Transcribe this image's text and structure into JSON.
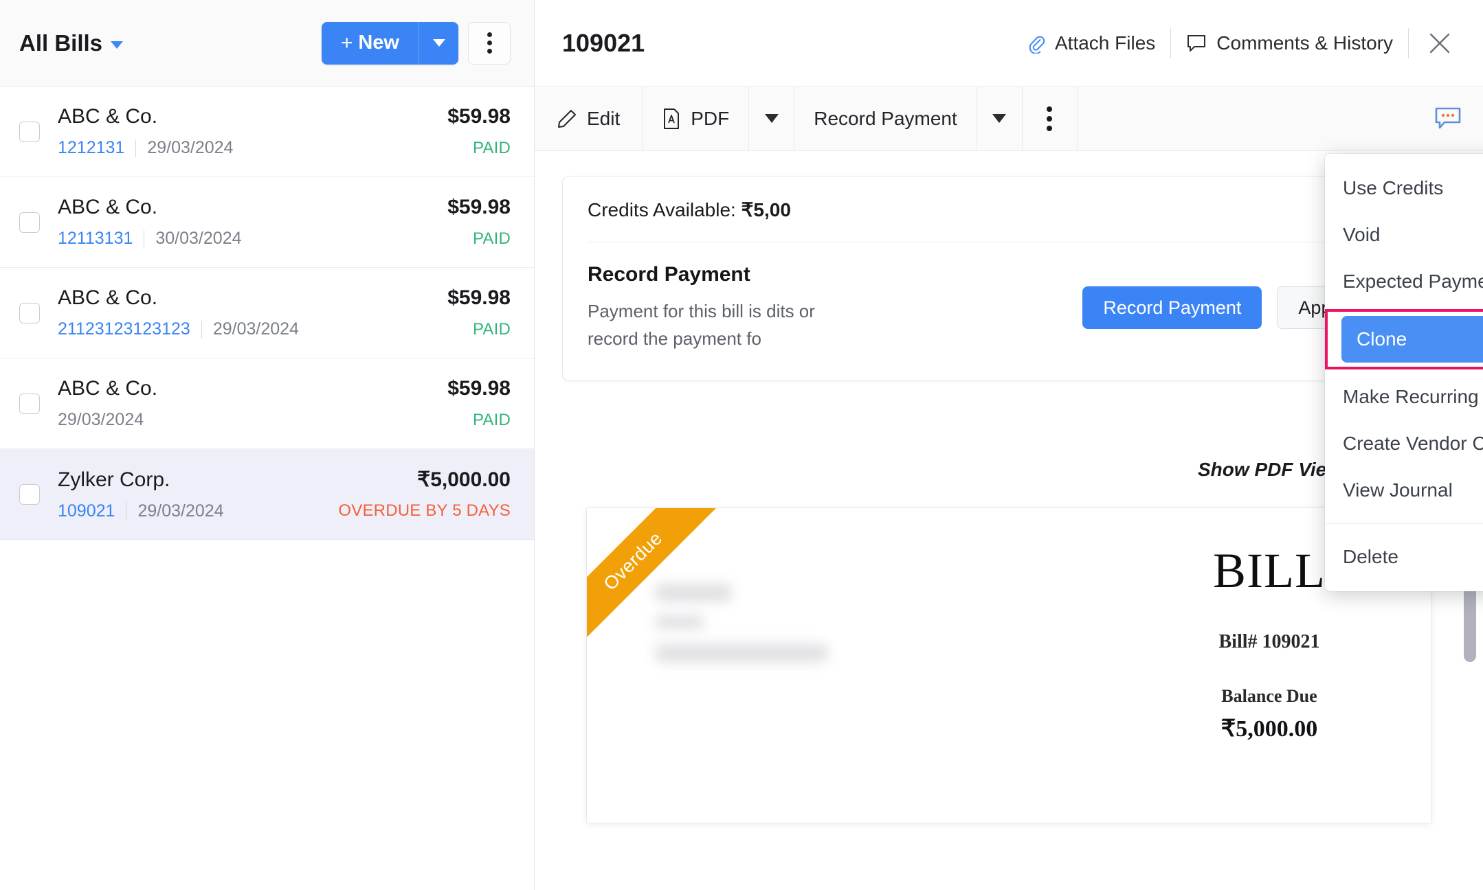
{
  "left_pane": {
    "view_label": "All Bills",
    "new_button": "+ New",
    "new_plus": "+",
    "new_text": "New",
    "bills": [
      {
        "vendor": "ABC & Co.",
        "amount": "$59.98",
        "number": "1212131",
        "date": "29/03/2024",
        "status": "PAID",
        "status_type": "paid",
        "selected": false
      },
      {
        "vendor": "ABC & Co.",
        "amount": "$59.98",
        "number": "12113131",
        "date": "30/03/2024",
        "status": "PAID",
        "status_type": "paid",
        "selected": false
      },
      {
        "vendor": "ABC & Co.",
        "amount": "$59.98",
        "number": "21123123123123",
        "date": "29/03/2024",
        "status": "PAID",
        "status_type": "paid",
        "selected": false
      },
      {
        "vendor": "ABC & Co.",
        "amount": "$59.98",
        "number": "",
        "date": "29/03/2024",
        "status": "PAID",
        "status_type": "paid",
        "selected": false
      },
      {
        "vendor": "Zylker Corp.",
        "amount": "₹5,000.00",
        "number": "109021",
        "date": "29/03/2024",
        "status": "OVERDUE BY 5 DAYS",
        "status_type": "overdue",
        "selected": true
      }
    ]
  },
  "detail": {
    "title": "109021",
    "attach_files": "Attach Files",
    "comments_history": "Comments & History",
    "toolbar": {
      "edit": "Edit",
      "pdf": "PDF",
      "record_payment": "Record Payment"
    },
    "credits_card": {
      "credits_available_label": "Credits Available: ",
      "credits_available_value": "₹5,00",
      "title": "Record Payment",
      "description_line1": "Payment for this bill is",
      "description_line2": "record the payment fo",
      "description_tail": "dits or",
      "record_payment_button": "Record Payment",
      "apply_credits_button": "Apply Credits"
    },
    "pdf_toggle_label": "Show PDF View",
    "pdf_preview": {
      "ribbon": "Overdue",
      "bill_word": "BILL",
      "bill_number": "Bill# 109021",
      "balance_due_label": "Balance Due",
      "balance_due_amount": "₹5,000.00"
    }
  },
  "menu": {
    "items": [
      {
        "label": "Use Credits",
        "highlighted": false
      },
      {
        "label": "Void",
        "highlighted": false
      },
      {
        "label": "Expected Payment Date",
        "highlighted": false
      },
      {
        "label": "Clone",
        "highlighted": true
      },
      {
        "label": "Make Recurring",
        "highlighted": false
      },
      {
        "label": "Create Vendor Credits",
        "highlighted": false
      },
      {
        "label": "View Journal",
        "highlighted": false
      }
    ],
    "delete": "Delete"
  },
  "colors": {
    "accent_blue": "#3b84f5",
    "paid_green": "#33b579",
    "overdue_orange": "#f4613a",
    "ribbon_orange": "#f2a007",
    "highlight_pink": "#eb1464"
  }
}
